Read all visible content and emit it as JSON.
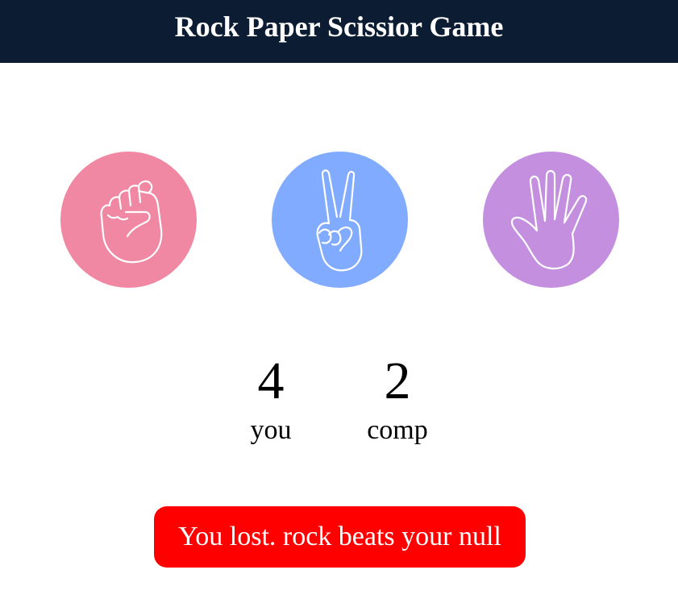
{
  "header": {
    "title": "Rock Paper Scissior Game"
  },
  "choices": [
    {
      "id": "rock",
      "icon": "rock-fist-icon",
      "color": "#f087a3"
    },
    {
      "id": "scissors",
      "icon": "scissors-hand-icon",
      "color": "#80abff"
    },
    {
      "id": "paper",
      "icon": "paper-hand-icon",
      "color": "#c48fdf"
    }
  ],
  "scoreboard": {
    "you": {
      "score": "4",
      "label": "you"
    },
    "comp": {
      "score": "2",
      "label": "comp"
    }
  },
  "message": {
    "text": "You lost. rock beats your null",
    "color": "#ff0000"
  },
  "colors": {
    "header_bg": "#0c1c33",
    "header_text": "#ffffff"
  }
}
